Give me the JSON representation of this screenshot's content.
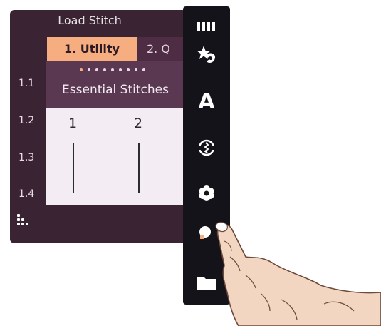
{
  "panel": {
    "title": "Load Stitch",
    "tabs": [
      {
        "label": "1. Utility",
        "active": true
      },
      {
        "label": "2. Q",
        "active": false
      }
    ],
    "page_indicator": {
      "count": 9,
      "active_index": 0
    },
    "card_title": "Essential Stitches",
    "stitches": [
      {
        "number": "1"
      },
      {
        "number": "2"
      }
    ],
    "row_labels": [
      "1.1",
      "1.2",
      "1.3",
      "1.4"
    ]
  },
  "toolbar": {
    "buttons": [
      {
        "icon": "grid-columns-icon"
      },
      {
        "icon": "favorite-stitch-icon"
      },
      {
        "icon": "font-icon",
        "label": "A"
      },
      {
        "icon": "stitch-program-icon"
      },
      {
        "icon": "settings-gear-icon"
      },
      {
        "icon": "info-icon"
      },
      {
        "icon": "folder-icon"
      }
    ]
  },
  "colors": {
    "panel_bg": "#3a2333",
    "active_tab": "#f6ad80",
    "card_header": "#5a3852",
    "card_body": "#f3ecf2",
    "toolbar_bg": "#15131a"
  }
}
